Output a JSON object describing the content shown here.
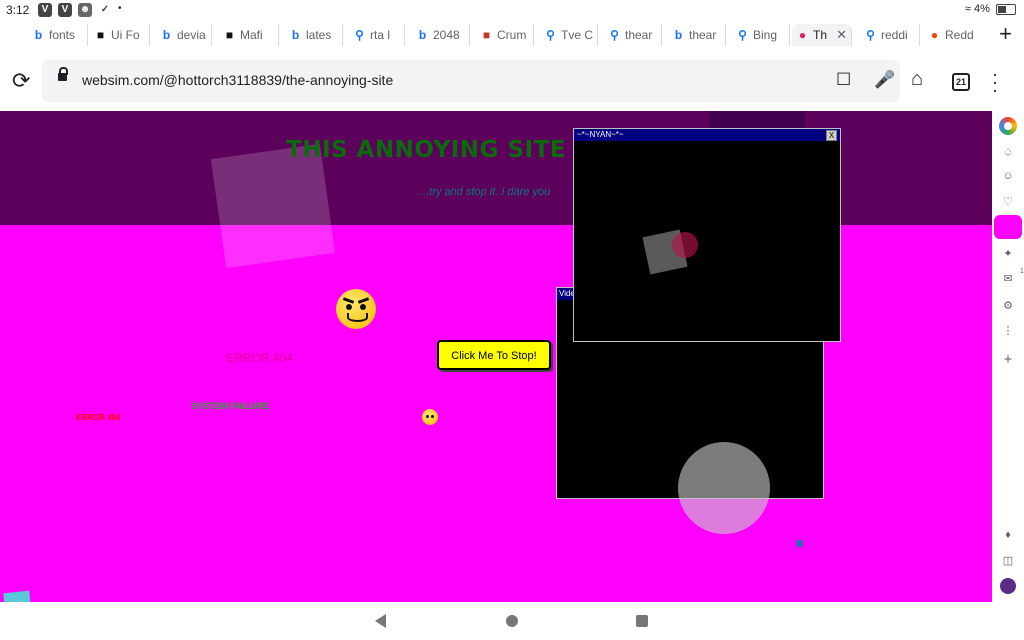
{
  "status": {
    "time": "3:12",
    "battery": "4%",
    "apps": [
      "V",
      "V",
      "✓"
    ]
  },
  "tabs": [
    {
      "icon": "b",
      "label": "fonts",
      "color": "#1a73e8"
    },
    {
      "icon": "■",
      "label": "Ui Fo",
      "color": "#111111"
    },
    {
      "icon": "b",
      "label": "devia",
      "color": "#1a73e8"
    },
    {
      "icon": "■",
      "label": "Mafi",
      "color": "#111111"
    },
    {
      "icon": "b",
      "label": "lates",
      "color": "#1a73e8"
    },
    {
      "icon": "⌕",
      "label": "rta l",
      "color": "#1a73e8"
    },
    {
      "icon": "b",
      "label": "2048",
      "color": "#1a73e8"
    },
    {
      "icon": "■",
      "label": "Crum",
      "color": "#c0392b"
    },
    {
      "icon": "⌕",
      "label": "Tve C",
      "color": "#1a73e8"
    },
    {
      "icon": "⌕",
      "label": "thear",
      "color": "#1a73e8"
    },
    {
      "icon": "b",
      "label": "thear",
      "color": "#1a73e8"
    },
    {
      "icon": "⌕",
      "label": "Bing",
      "color": "#1a73e8"
    },
    {
      "icon": "●",
      "label": "Th",
      "color": "#e91e63"
    },
    {
      "icon": "⌕",
      "label": "reddi",
      "color": "#1a73e8"
    },
    {
      "icon": "●",
      "label": "Redd",
      "color": "#ff4500"
    }
  ],
  "new_tab": "+",
  "toolbar": {
    "url": "websim.com/@hottorch3118839/the-annoying-site",
    "tab_count": "21"
  },
  "page": {
    "title": "THIS ANNOYING SITE W",
    "subtitle": "...try and stop it. I dare you",
    "button": "Click Me To Stop!",
    "errors": [
      {
        "text": "ERROR 404",
        "color": "#d00060"
      },
      {
        "text": "SYSTEM FAILURE",
        "color": "#22aa22"
      },
      {
        "text": "ERROR 404",
        "color": "#ff0000"
      }
    ],
    "popup_title": "~*~NYAN~*~",
    "popup_close": "X",
    "video_title": "Video"
  },
  "rail_badge": "1"
}
